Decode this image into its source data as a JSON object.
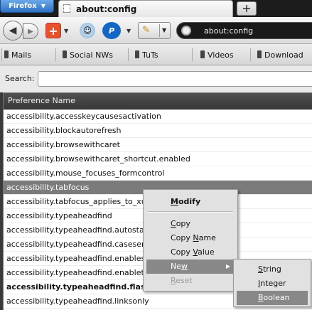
{
  "browser": {
    "menu_button_label": "Firefox",
    "tab_title": "about:config",
    "new_tab_label": "+"
  },
  "navbar": {
    "back_glyph": "◀",
    "forward_glyph": "▶",
    "addon1_glyph": "+",
    "addon3_glyph": "P",
    "url": "about:config"
  },
  "bookmarks": [
    "Mails",
    "Social NWs",
    "TuTs",
    "Videos",
    "Download"
  ],
  "search": {
    "label": "Search:",
    "value": ""
  },
  "table": {
    "column_header": "Preference Name",
    "rows": [
      "accessibility.accesskeycausesactivation",
      "accessibility.blockautorefresh",
      "accessibility.browsewithcaret",
      "accessibility.browsewithcaret_shortcut.enabled",
      "accessibility.mouse_focuses_formcontrol",
      "accessibility.tabfocus",
      "accessibility.tabfocus_applies_to_xul",
      "accessibility.typeaheadfind",
      "accessibility.typeaheadfind.autostart",
      "accessibility.typeaheadfind.casesensitive",
      "accessibility.typeaheadfind.enablesound",
      "accessibility.typeaheadfind.enabletimeout",
      "accessibility.typeaheadfind.flashBar",
      "accessibility.typeaheadfind.linksonly"
    ],
    "selected_row": "accessibility.tabfocus",
    "bold_row": "accessibility.typeaheadfind.flashBar"
  },
  "context_menu": {
    "modify": {
      "pre": "",
      "key": "M",
      "post": "odify"
    },
    "copy": {
      "pre": "",
      "key": "C",
      "post": "opy"
    },
    "copy_name": {
      "pre": "Copy ",
      "key": "N",
      "post": "ame"
    },
    "copy_value": {
      "pre": "Copy ",
      "key": "V",
      "post": "alue"
    },
    "new": {
      "pre": "Ne",
      "key": "w",
      "post": ""
    },
    "reset": {
      "pre": "",
      "key": "R",
      "post": "eset"
    }
  },
  "submenu": {
    "string": {
      "pre": "",
      "key": "S",
      "post": "tring"
    },
    "integer": {
      "pre": "",
      "key": "I",
      "post": "nteger"
    },
    "boolean": {
      "pre": "",
      "key": "B",
      "post": "oolean"
    }
  },
  "colors": {
    "menu_highlight": "#888888",
    "selected_row": "#7b7b7b",
    "firefox_button": "#2f72c4"
  }
}
